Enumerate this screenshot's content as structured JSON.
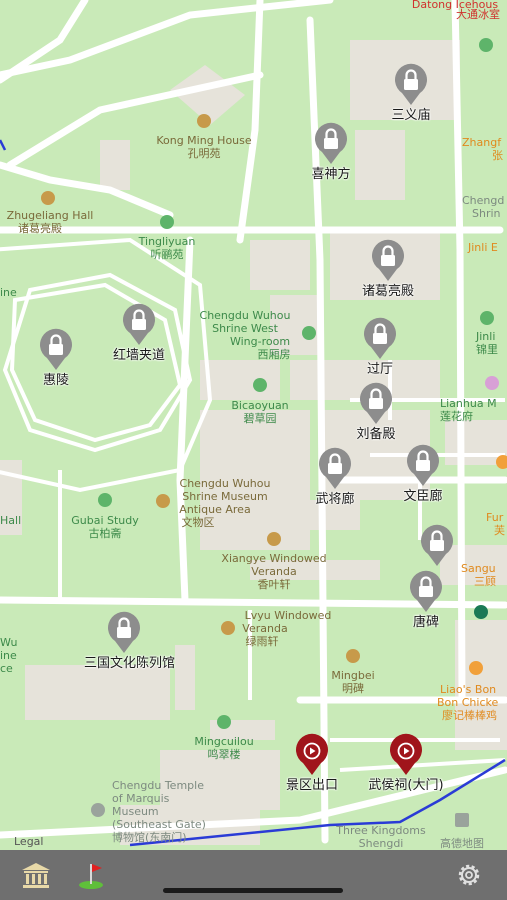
{
  "map": {
    "colors": {
      "park": "#c9eab8",
      "road": "#ffffff",
      "building": "#e6e3da",
      "pin": "#8d8d8d",
      "exit_pin": "#a0151b",
      "route": "#2a3bd6"
    },
    "labels": {
      "datong_en": "Datong Icehous",
      "datong_zh": "大通冰室",
      "kongming_en": "Kong Ming House",
      "kongming_zh": "孔明苑",
      "zhangfei_en": "Zhangf",
      "zhangfei_zh": "张",
      "zhugeliang_hall_en": "Zhugeliang Hall",
      "zhugeliang_hall_zh": "诸葛亮殿",
      "tingliyuan_en": "Tingliyuan",
      "tingliyuan_zh": "听鹂苑",
      "chengd_en": "Chengd",
      "shrin_en": "Shrin",
      "jinli_e_en": "Jinli E",
      "jinli_en": "Jinli",
      "jinli_zh": "锦里",
      "westwing_en_1": "Chengdu Wuhou",
      "westwing_en_2": "Shrine West",
      "westwing_en_3": "Wing-room",
      "westwing_zh": "西厢房",
      "bicaoyuan_en": "Bicaoyuan",
      "bicaoyuan_zh": "碧草园",
      "lianhua_en": "Lianhua M",
      "lianhua_zh": "莲花府",
      "museum_en_1": "Chengdu Wuhou",
      "museum_en_2": "Shrine Museum",
      "museum_en_3": "Antique Area",
      "museum_zh": "文物区",
      "gubai_en": "Gubai Study",
      "gubai_zh": "古柏斋",
      "hall_left": "Hall",
      "ine_left": "ine",
      "wu_left": "Wu",
      "ine2_left": "ine",
      "ce_left": "ce",
      "fur_right": "Fur",
      "fur_zh": "芙",
      "xiangye_en_1": "Xiangye Windowed",
      "xiangye_en_2": "Veranda",
      "xiangye_zh": "香叶轩",
      "sangu_en": "Sangu",
      "sangu_zh": "三顾",
      "lvyu_en_1": "Lvyu Windowed",
      "lvyu_en_2": "Veranda",
      "lvyu_zh": "绿雨轩",
      "mingbei_en": "Mingbei",
      "mingbei_zh": "明碑",
      "liaos_en_1": "Liao's Bon",
      "liaos_en_2": "Bon Chicke",
      "liaos_zh": "廖记棒棒鸡",
      "mingcuilou_en": "Mingcuilou",
      "mingcuilou_zh": "鸣翠楼",
      "temple_en_1": "Chengdu Temple",
      "temple_en_2": "of Marquis",
      "temple_en_3": "Museum",
      "temple_en_4": "(Southeast Gate)",
      "temple_zh": "博物馆(东南门)",
      "threekingdoms_en": "Three Kingdoms",
      "threekingdoms_en_2": "Shengdi",
      "gaode_zh": "高德地图",
      "legal": "Legal"
    },
    "locked_sites": [
      {
        "name": "三义庙"
      },
      {
        "name": "喜神方"
      },
      {
        "name": "诸葛亮殿"
      },
      {
        "name": "红墙夹道"
      },
      {
        "name": "惠陵"
      },
      {
        "name": "过厅"
      },
      {
        "name": "刘备殿"
      },
      {
        "name": "武将廊"
      },
      {
        "name": "文臣廊"
      },
      {
        "name": ""
      },
      {
        "name": "唐碑"
      },
      {
        "name": "三国文化陈列馆"
      }
    ],
    "exit_sites": [
      {
        "name": "景区出口"
      },
      {
        "name": "武侯祠(大门)"
      }
    ]
  },
  "tabbar": {
    "items": [
      {
        "icon": "museum-icon"
      },
      {
        "icon": "golf-flag-icon"
      },
      {
        "icon": "gear-icon"
      }
    ]
  }
}
